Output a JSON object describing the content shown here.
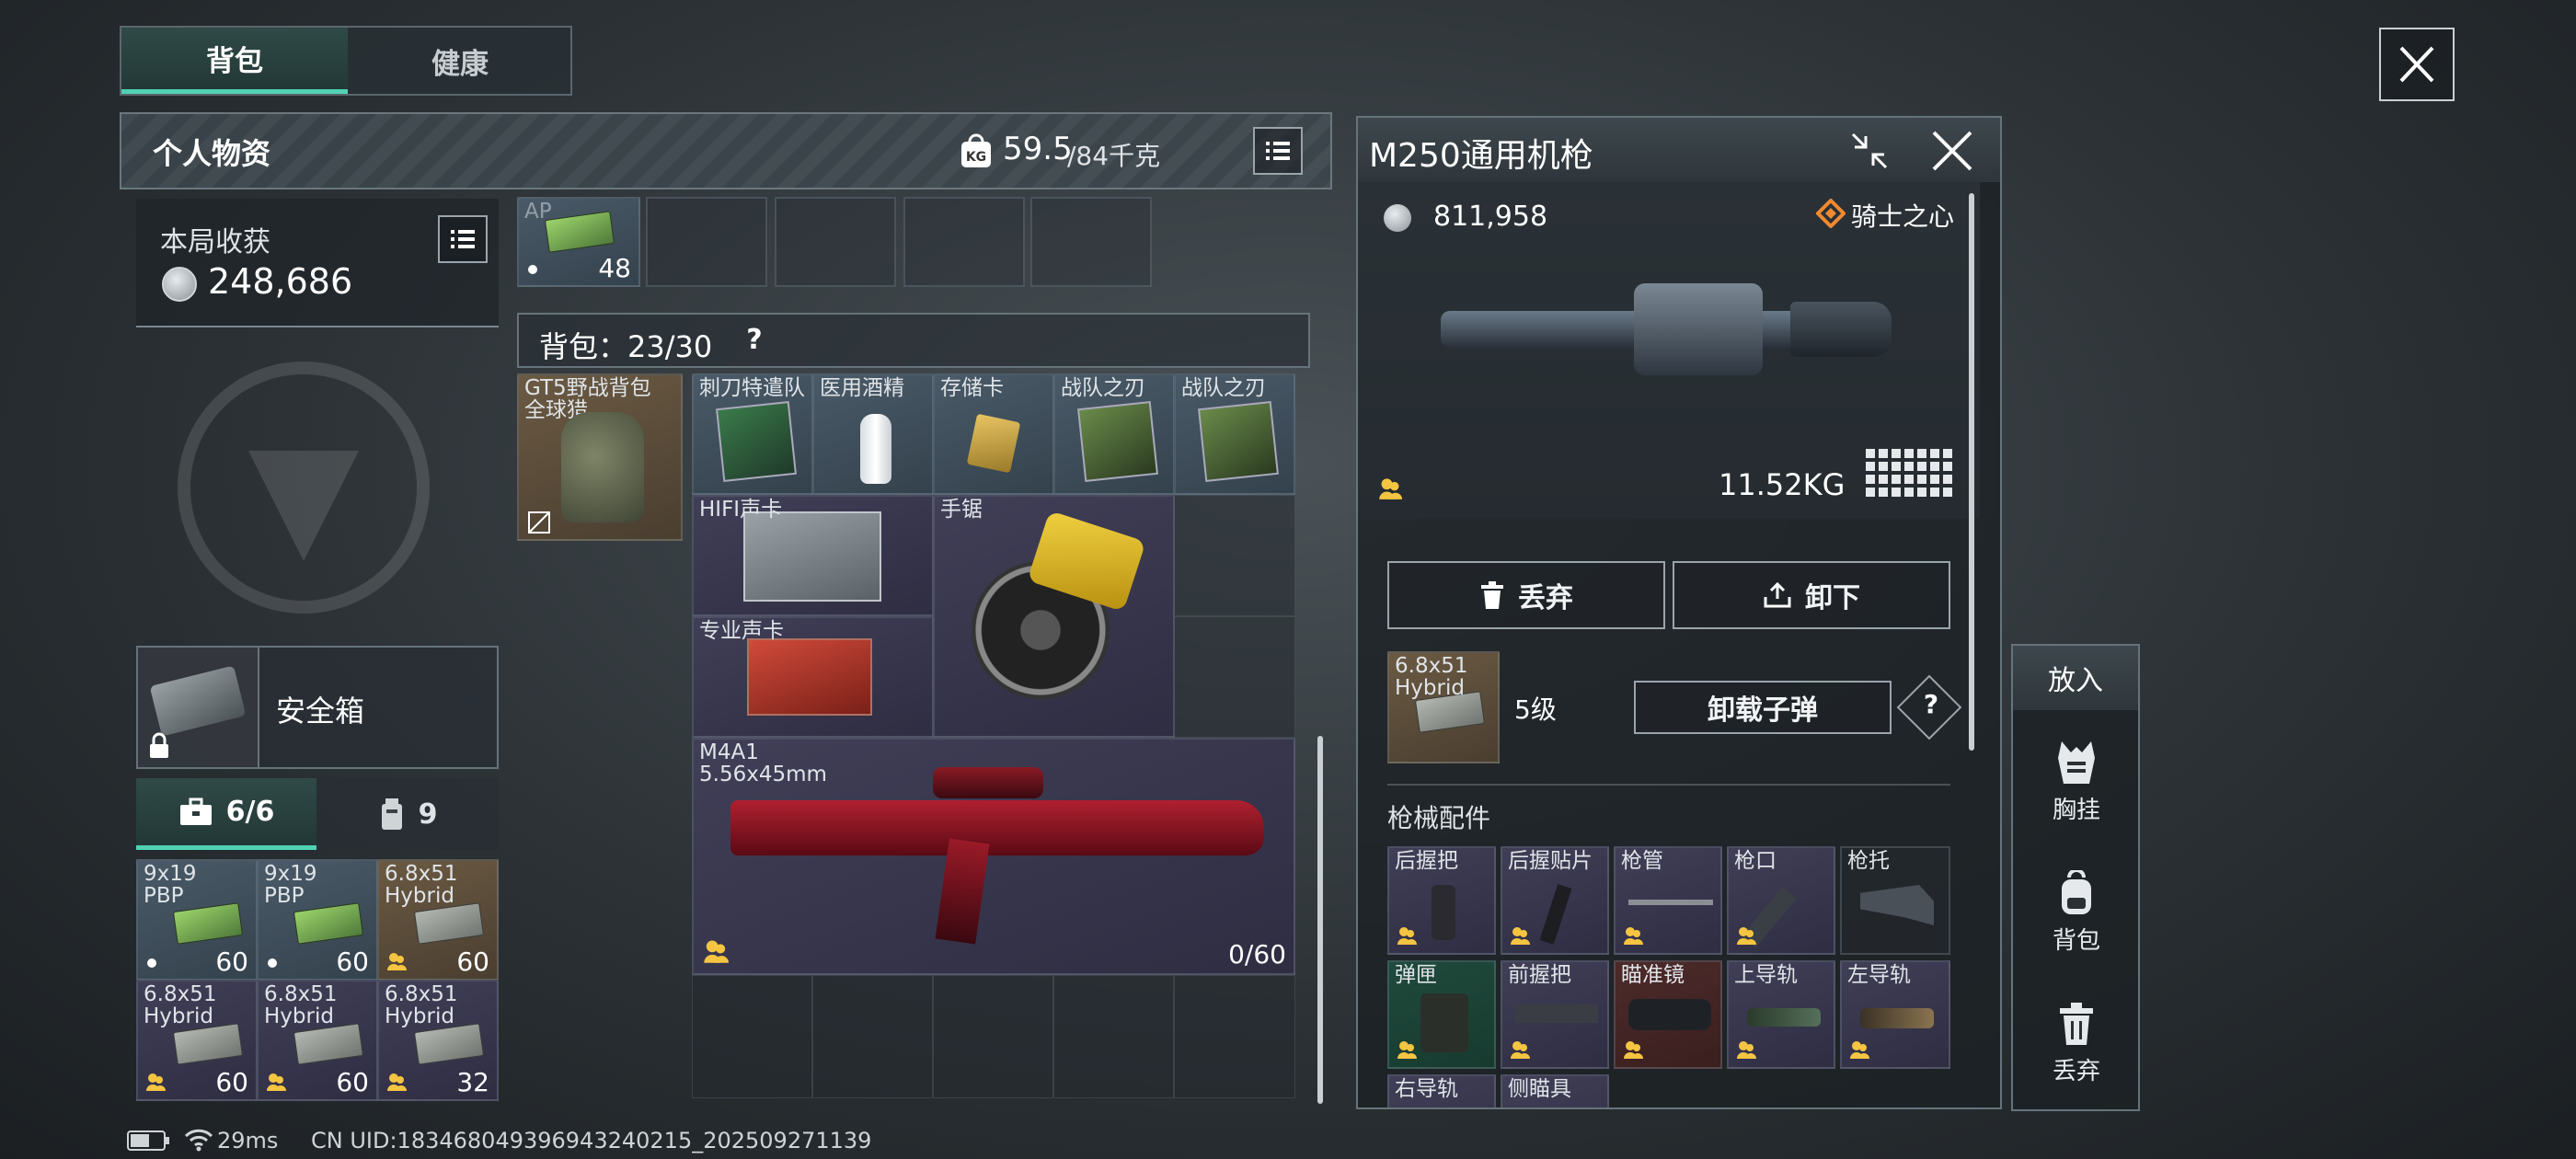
{
  "tabs": [
    {
      "label": "背包",
      "active": true
    },
    {
      "label": "健康",
      "active": false
    }
  ],
  "personal": {
    "title": "个人物资",
    "weight_value": "59.5",
    "weight_max": "/84千克"
  },
  "earnings": {
    "label": "本局收获",
    "value": "248,686"
  },
  "top_slot": {
    "label": "AP",
    "count": "48"
  },
  "backpack": {
    "label": "背包：23/30",
    "help": "?"
  },
  "gt5": {
    "label_line1": "GT5野战背包",
    "label_line2": "全球猎"
  },
  "items": {
    "row1": [
      "刺刀特遣队",
      "医用酒精",
      "存储卡",
      "战队之刃",
      "战队之刃"
    ],
    "hifi": "HIFI声卡",
    "saw": "手锯",
    "pro_card": "专业声卡",
    "m4a1_line1": "M4A1",
    "m4a1_line2": "5.56x45mm",
    "m4a1_ammo": "0/60"
  },
  "safe_box": {
    "label": "安全箱"
  },
  "pouch_tabs": [
    {
      "label": "6/6",
      "icon": "toolbox-icon"
    },
    {
      "label": "9",
      "icon": "canister-icon"
    }
  ],
  "pouch_slots": [
    {
      "l1": "9x19",
      "l2": "PBP",
      "count": "60",
      "marker": "dot",
      "bg": "blue"
    },
    {
      "l1": "9x19",
      "l2": "PBP",
      "count": "60",
      "marker": "dot",
      "bg": "blue"
    },
    {
      "l1": "6.8x51",
      "l2": "Hybrid",
      "count": "60",
      "marker": "people",
      "bg": "tan"
    },
    {
      "l1": "6.8x51",
      "l2": "Hybrid",
      "count": "60",
      "marker": "people",
      "bg": "purp"
    },
    {
      "l1": "6.8x51",
      "l2": "Hybrid",
      "count": "60",
      "marker": "people",
      "bg": "purp"
    },
    {
      "l1": "6.8x51",
      "l2": "Hybrid",
      "count": "32",
      "marker": "people",
      "bg": "purp"
    }
  ],
  "weapon": {
    "title": "M250通用机枪",
    "price": "811,958",
    "skin": "骑士之心",
    "weight": "11.52KG",
    "discard": "丢弃",
    "unload": "卸下",
    "ammo_l1": "6.8x51",
    "ammo_l2": "Hybrid",
    "ammo_level": "5级",
    "unload_ammo": "卸载子弹",
    "help": "?",
    "attachments_title": "枪械配件",
    "attachments": [
      {
        "label": "后握把",
        "bg": "purp"
      },
      {
        "label": "后握贴片",
        "bg": "purp"
      },
      {
        "label": "枪管",
        "bg": "purp"
      },
      {
        "label": "枪口",
        "bg": "purp"
      },
      {
        "label": "枪托",
        "bg": "dark"
      },
      {
        "label": "弹匣",
        "bg": "green"
      },
      {
        "label": "前握把",
        "bg": "purp"
      },
      {
        "label": "瞄准镜",
        "bg": "red"
      },
      {
        "label": "上导轨",
        "bg": "purp"
      },
      {
        "label": "左导轨",
        "bg": "purp"
      },
      {
        "label": "右导轨",
        "bg": "purp"
      },
      {
        "label": "侧瞄具",
        "bg": "purp"
      }
    ]
  },
  "side_panel": {
    "title": "放入",
    "buttons": [
      {
        "label": "胸挂",
        "icon": "vest-icon"
      },
      {
        "label": "背包",
        "icon": "backpack-icon"
      },
      {
        "label": "丢弃",
        "icon": "trash-icon"
      }
    ]
  },
  "status": {
    "ping": "29ms",
    "uid": "CN UID:18346804939694324021​5_202509271139"
  }
}
